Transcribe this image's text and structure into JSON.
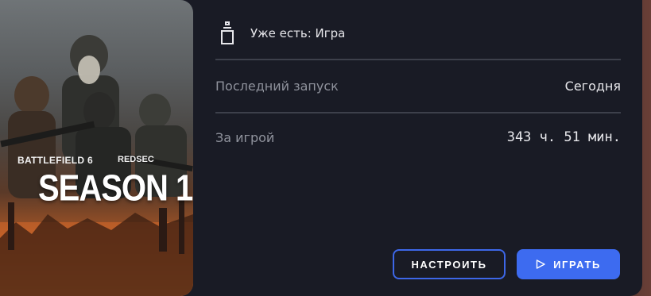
{
  "cover": {
    "brand": "BATTLEFIELD 6",
    "brand_secondary": "REDSEC",
    "season": "SEASON 1"
  },
  "ownership": {
    "icon": "ownership-icon",
    "text": "Уже есть: Игра"
  },
  "stats": {
    "last_launch": {
      "label": "Последний запуск",
      "value": "Сегодня"
    },
    "playtime": {
      "label": "За игрой",
      "value": "343 ч. 51 мин."
    }
  },
  "buttons": {
    "setup_label": "НАСТРОИТЬ",
    "play_label": "ИГРАТЬ",
    "play_icon": "play-icon"
  },
  "colors": {
    "panel": "#191b25",
    "accent": "#3d6bf0",
    "divider": "#3d404b"
  }
}
